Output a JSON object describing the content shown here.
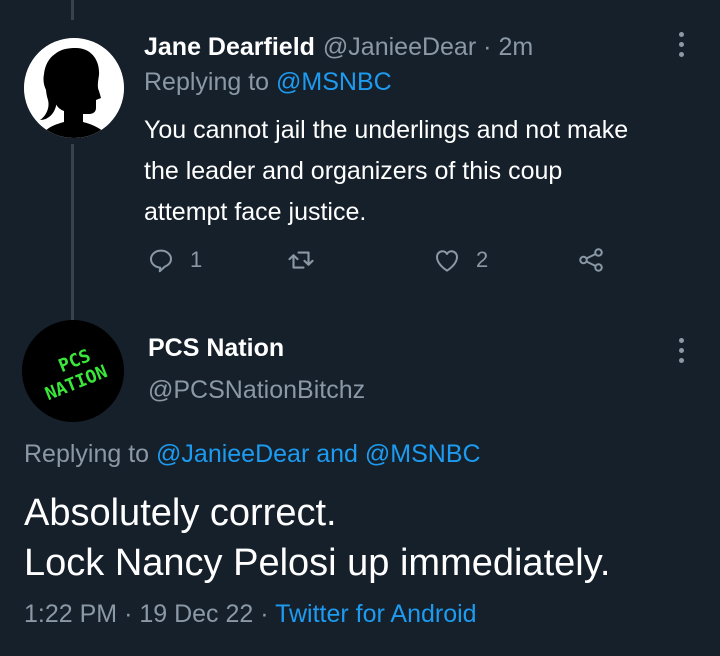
{
  "reply_tweet": {
    "author_name": "Jane Dearfield",
    "author_handle": "@JanieeDear",
    "separator": "·",
    "time": "2m",
    "replying_prefix": "Replying to",
    "replying_to": "@MSNBC",
    "text_lines": [
      "You cannot jail the underlings and not make",
      "the leader and organizers of this coup",
      "attempt face justice."
    ],
    "actions": {
      "reply_count": "1",
      "retweet_count": "",
      "like_count": "2"
    }
  },
  "main_tweet": {
    "author_name": "PCS Nation",
    "author_handle": "@PCSNationBitchz",
    "avatar_text": [
      "PCS",
      "NATION"
    ],
    "replying_prefix": "Replying to",
    "replying_to_1": "@JanieeDear",
    "replying_and": "and",
    "replying_to_2": "@MSNBC",
    "text_lines": [
      "Absolutely correct.",
      "Lock Nancy Pelosi up immediately."
    ],
    "time": "1:22 PM",
    "separator": "·",
    "date": "19 Dec 22",
    "source": "Twitter for Android"
  },
  "icons": {
    "reply": "speech-bubble-icon",
    "retweet": "retweet-icon",
    "like": "heart-icon",
    "share": "share-icon",
    "more": "three-dots-icon"
  },
  "colors": {
    "background": "#15202b",
    "link": "#1d9bf0",
    "secondary_text": "#8b98a5",
    "avatar_text": "#39e639"
  }
}
